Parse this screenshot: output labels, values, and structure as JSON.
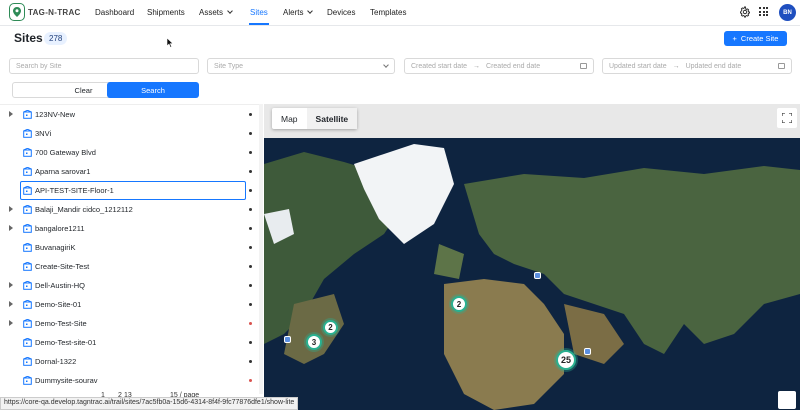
{
  "nav": {
    "brand": "TAG-N-TRAC",
    "items": [
      "Dashboard",
      "Shipments",
      "Assets",
      "Sites",
      "Alerts",
      "Devices",
      "Templates"
    ],
    "active": "Sites",
    "avatar": "BN"
  },
  "page": {
    "title": "Sites",
    "count": "278",
    "create_label": "Create Site"
  },
  "filters": {
    "search_placeholder": "Search by Site",
    "site_type_placeholder": "Site Type",
    "created_start": "Created start date",
    "created_end": "Created end date",
    "updated_start": "Updated start date",
    "updated_end": "Updated end date",
    "clear_label": "Clear",
    "search_label": "Search"
  },
  "sites": [
    {
      "name": "123NV-New",
      "expand": true,
      "status": "dark"
    },
    {
      "name": "3NVi",
      "expand": false,
      "status": "dark"
    },
    {
      "name": "700 Gateway Blvd",
      "expand": false,
      "status": "dark"
    },
    {
      "name": "Aparna sarovar1",
      "expand": false,
      "status": "dark"
    },
    {
      "name": "API-TEST-SITE-Floor-1",
      "expand": false,
      "status": "dark",
      "selected": true
    },
    {
      "name": "Balaji_Mandir cidco_1212112",
      "expand": true,
      "status": "dark"
    },
    {
      "name": "bangalore1211",
      "expand": true,
      "status": "dark"
    },
    {
      "name": "BuvanagiriK",
      "expand": false,
      "status": "dark"
    },
    {
      "name": "Create-Site-Test",
      "expand": false,
      "status": "dark"
    },
    {
      "name": "Dell-Austin-HQ",
      "expand": true,
      "status": "dark"
    },
    {
      "name": "Demo-Site-01",
      "expand": true,
      "status": "dark"
    },
    {
      "name": "Demo-Test-Site",
      "expand": true,
      "status": "red"
    },
    {
      "name": "Demo-Test-site-01",
      "expand": false,
      "status": "dark"
    },
    {
      "name": "Dornal-1322",
      "expand": false,
      "status": "dark"
    },
    {
      "name": "Dummysite-sourav",
      "expand": false,
      "status": "red"
    }
  ],
  "pager": {
    "pages": [
      "1",
      "2",
      "13"
    ],
    "page_size": "15 / page"
  },
  "map": {
    "tabs": [
      "Map",
      "Satellite"
    ],
    "active_tab": "Satellite",
    "clusters": [
      "2",
      "2",
      "3",
      "25"
    ]
  },
  "status_url": "https://core-qa.develop.tagntrac.ai/trail/sites/7ac5fb0a-15d6-4314-8f4f-9fc77876dfe1/show-lite"
}
